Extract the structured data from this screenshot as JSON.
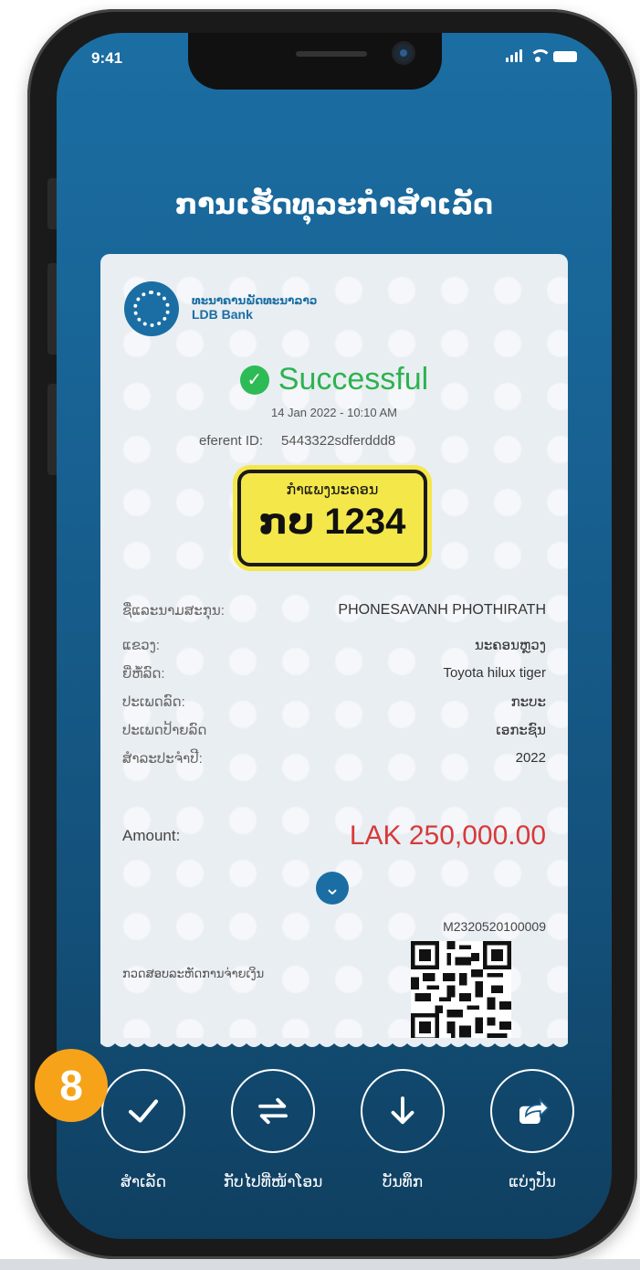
{
  "status_bar": {
    "time": "9:41"
  },
  "title": "ການເຮັດທຸລະກຳສຳເລັດ",
  "receipt": {
    "bank_name_lao": "ທະນາຄານພັດທະນາລາວ",
    "bank_name_en": "LDB Bank",
    "status": "Successful",
    "datetime": "14 Jan 2022 - 10:10 AM",
    "reference_label": "eferent ID:",
    "reference_id": "5443322sdferddd8",
    "plate_label": "ກຳແພງນະຄອນ",
    "plate_number": "ກບ 1234",
    "details": [
      {
        "label": "ຊື່ແລະນາມສະກຸນ:",
        "value": "PHONESAVANH PHOTHIRATH"
      },
      {
        "label": "ແຂວງ:",
        "value": "ນະຄອນຫຼວງ"
      },
      {
        "label": "ຍີ່ຫໍ້ລົດ:",
        "value": "Toyota hilux tiger"
      },
      {
        "label": "ປະເພດລົດ:",
        "value": "ກະບະ"
      },
      {
        "label": "ປະເພດປ້າຍລົດ",
        "value": "ເອກະຊົນ"
      },
      {
        "label": "ສຳລະປະຈຳປີ:",
        "value": "2022"
      }
    ],
    "amount_label": "Amount:",
    "amount_value": "LAK 250,000.00",
    "transaction_code": "M2320520100009",
    "verify_text": "ກວດສອບລະຫັດການຈ່າຍເງິນ"
  },
  "actions": [
    {
      "label": "ສຳເລັດ",
      "icon": "check-icon"
    },
    {
      "label": "ກັບໄປທີ່ໜ້າໂອນ",
      "icon": "transfer-arrows-icon"
    },
    {
      "label": "ບັນທຶກ",
      "icon": "download-icon"
    },
    {
      "label": "ແບ່ງປັນ",
      "icon": "share-icon"
    }
  ],
  "step_badge": "8",
  "colors": {
    "brand_blue": "#1b6ea3",
    "success_green": "#2db34e",
    "amount_red": "#d63a3a",
    "plate_yellow": "#f4e74a",
    "badge_orange": "#f6a31a"
  }
}
